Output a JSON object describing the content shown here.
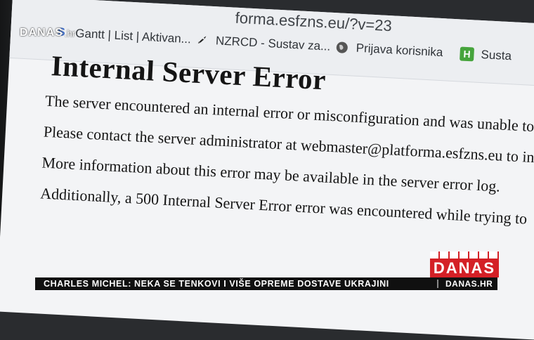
{
  "browser": {
    "url_fragment": "forma.esfzns.eu/?v=23",
    "bookmarks": [
      {
        "label": "Gantt | List | Aktivan...",
        "icon": "gantt-icon"
      },
      {
        "label": "NZRCD - Sustav za...",
        "icon": "rocket-icon"
      },
      {
        "label": "Prijava korisnika",
        "icon": "globe-icon"
      },
      {
        "label": "Susta",
        "icon": "h-icon"
      }
    ]
  },
  "page": {
    "title": "Internal Server Error",
    "lines": [
      "The server encountered an internal error or misconfiguration and was unable to",
      "Please contact the server administrator at webmaster@platforma.esfzns.eu to in",
      "More information about this error may be available in the server error log.",
      "Additionally, a 500 Internal Server Error error was encountered while trying to"
    ]
  },
  "overlay": {
    "logo_main": "DANAS",
    "logo_suffix": ".hr",
    "bug_label": "DANAS",
    "ticker_headline": "CHARLES MICHEL: NEKA SE TENKOVI I VIŠE OPREME DOSTAVE UKRAJINI",
    "ticker_brand": "DANAS.HR",
    "brand_color": "#d42026"
  }
}
